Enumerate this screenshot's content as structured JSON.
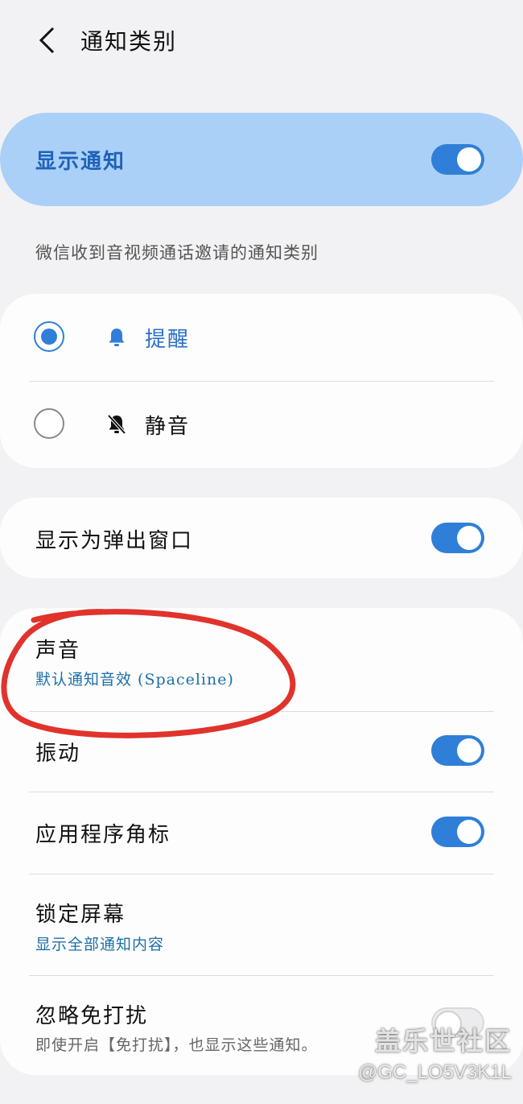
{
  "header": {
    "back_icon": "chevron-left-icon",
    "title": "通知类别"
  },
  "master": {
    "label": "显示通知",
    "on": true
  },
  "description": "微信收到音视频通话邀请的通知类别",
  "mode_options": [
    {
      "label": "提醒",
      "icon": "bell-icon",
      "selected": true
    },
    {
      "label": "静音",
      "icon": "bell-off-icon",
      "selected": false
    }
  ],
  "popup": {
    "label": "显示为弹出窗口",
    "on": true
  },
  "settings": {
    "sound": {
      "label": "声音",
      "value": "默认通知音效 (Spaceline)"
    },
    "vibration": {
      "label": "振动",
      "on": true
    },
    "badge": {
      "label": "应用程序角标",
      "on": true
    },
    "lock_screen": {
      "label": "锁定屏幕",
      "value": "显示全部通知内容"
    },
    "dnd_override": {
      "label": "忽略免打扰",
      "desc": "即使开启【免打扰】，也显示这些通知。",
      "on": false
    }
  },
  "watermark": {
    "brand": "盖乐世社区",
    "user": "@GC_LO5V3K1L"
  },
  "colors": {
    "accent": "#2f7fd8",
    "master_bg": "#abd0f7",
    "sub_text": "#1c6fa8",
    "annotation": "#e0332c"
  }
}
